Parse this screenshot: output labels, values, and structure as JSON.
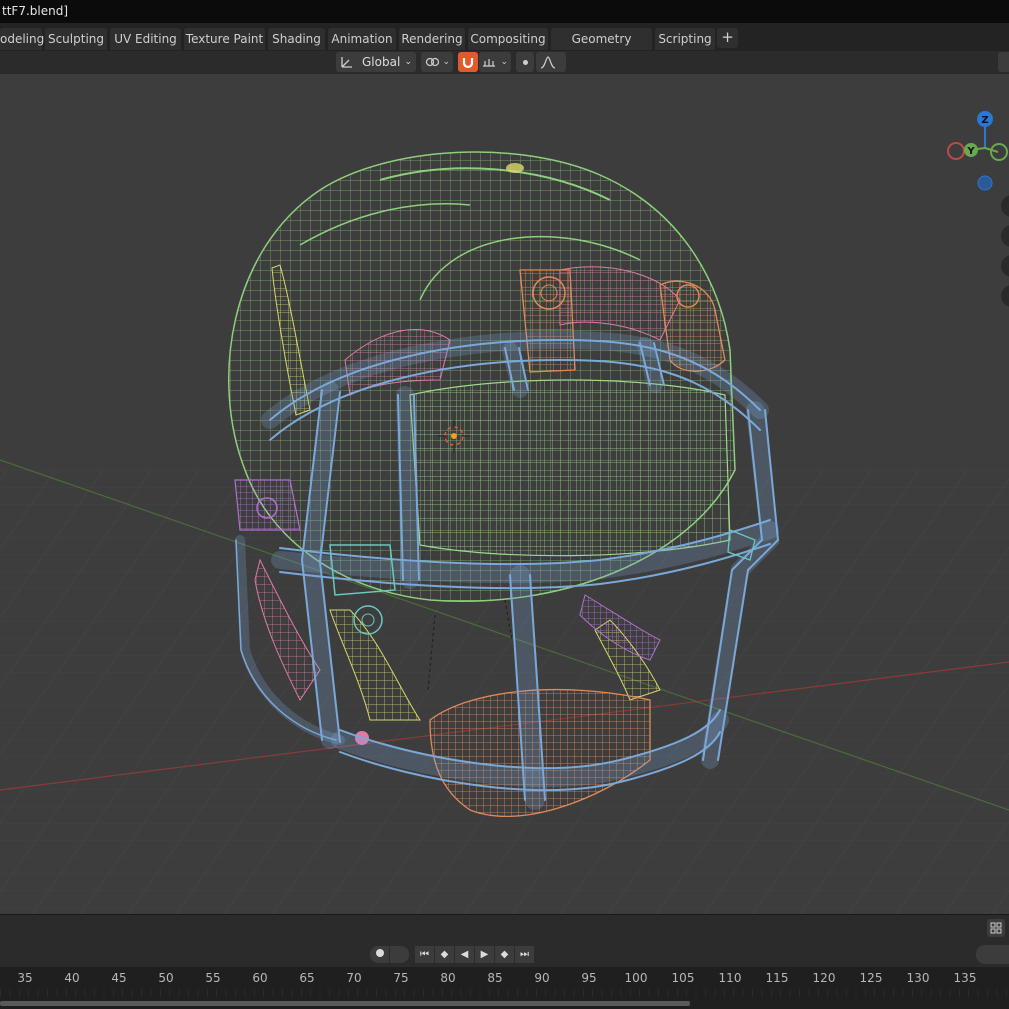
{
  "window": {
    "title": "ttF7.blend]"
  },
  "workspace_tabs": [
    {
      "label": "odeling"
    },
    {
      "label": "Sculpting"
    },
    {
      "label": "UV Editing"
    },
    {
      "label": "Texture Paint"
    },
    {
      "label": "Shading"
    },
    {
      "label": "Animation"
    },
    {
      "label": "Rendering"
    },
    {
      "label": "Compositing"
    },
    {
      "label": "Geometry Nodes"
    },
    {
      "label": "Scripting"
    }
  ],
  "add_workspace": {
    "label": "+"
  },
  "header": {
    "transform_orientation": {
      "value": "Global",
      "icon": "transform-axes-icon"
    },
    "pivot": {
      "icon": "link-icon"
    },
    "snap": {
      "icon": "magnet-icon",
      "active_color": "#e05a2a"
    },
    "snap_target": {
      "icon": "snap-increment-icon"
    },
    "proportional": {
      "icon": "proportional-dot-icon"
    },
    "falloff": {
      "icon": "falloff-curve-icon"
    }
  },
  "navigation_gizmo": {
    "axes": [
      {
        "label": "Z",
        "color": "#2b78d4"
      },
      {
        "label": "Y",
        "color": "#6aa84f"
      }
    ],
    "tools": [
      "zoom-icon",
      "pan-icon",
      "camera-icon",
      "grid-icon"
    ]
  },
  "viewport": {
    "background": "#3d3d3d",
    "wire_colors": {
      "shell": "#8ecf7c",
      "facemask": "#7aa8d8",
      "hardware": "#e08a5a",
      "padding_pink": "#e07aa8",
      "padding_yellow": "#d8d86a",
      "clip_purple": "#b070d0",
      "teal": "#6ac8c0"
    }
  },
  "timeline": {
    "ruler_ticks": [
      "35",
      "40",
      "45",
      "50",
      "55",
      "60",
      "65",
      "70",
      "75",
      "80",
      "85",
      "90",
      "95",
      "100",
      "105",
      "110",
      "115",
      "120",
      "125",
      "130",
      "135"
    ],
    "controls": [
      "record-icon",
      "jump-start-icon",
      "prev-keyframe-icon",
      "play-reverse-icon",
      "play-icon",
      "next-keyframe-icon",
      "jump-end-icon"
    ]
  }
}
